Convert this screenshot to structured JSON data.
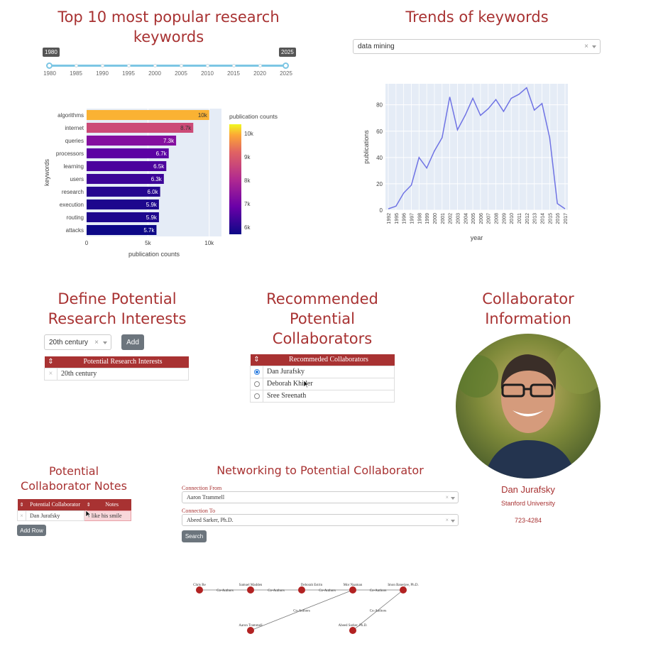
{
  "top_keywords": {
    "title_line1": "Top 10 most popular research",
    "title_line2": "keywords",
    "slider": {
      "min_label": "1980",
      "max_label": "2025",
      "ticks": [
        "1980",
        "1985",
        "1990",
        "1995",
        "2000",
        "2005",
        "2010",
        "2015",
        "2020",
        "2025"
      ]
    }
  },
  "bar_chart": {
    "chart_data": {
      "type": "bar",
      "orientation": "horizontal",
      "categories": [
        "algorithms",
        "internet",
        "queries",
        "processors",
        "learning",
        "users",
        "research",
        "execution",
        "routing",
        "attacks"
      ],
      "values": [
        10000,
        8700,
        7300,
        6700,
        6500,
        6300,
        6000,
        5900,
        5900,
        5700
      ],
      "value_labels": [
        "10k",
        "8.7k",
        "7.3k",
        "6.7k",
        "6.5k",
        "6.3k",
        "6.0k",
        "5.9k",
        "5.9k",
        "5.7k"
      ],
      "xlabel": "publication counts",
      "ylabel": "keywords",
      "x_ticks": [
        "0",
        "5k",
        "10k"
      ],
      "xlim": [
        0,
        11000
      ],
      "colorbar_title": "publication counts",
      "colorbar_ticks": [
        "10k",
        "9k",
        "8k",
        "7k",
        "6k"
      ],
      "colorbar_range": [
        5700,
        10400
      ],
      "bg_color": "#e5ecf6"
    }
  },
  "trends": {
    "title": "Trends of keywords",
    "dropdown_value": "data mining",
    "chart_data": {
      "type": "line",
      "x": [
        "1992",
        "1995",
        "1996",
        "1997",
        "1998",
        "1999",
        "2000",
        "2001",
        "2002",
        "2003",
        "2004",
        "2005",
        "2006",
        "2007",
        "2008",
        "2009",
        "2010",
        "2011",
        "2012",
        "2013",
        "2014",
        "2015",
        "2016",
        "2017"
      ],
      "y": [
        1,
        3,
        13,
        19,
        40,
        32,
        45,
        55,
        86,
        61,
        72,
        85,
        72,
        77,
        84,
        75,
        85,
        88,
        93,
        76,
        81,
        55,
        5,
        1
      ],
      "xlabel": "year",
      "ylabel": "publications",
      "y_ticks": [
        "0",
        "20",
        "40",
        "60",
        "80"
      ],
      "ylim": [
        0,
        96
      ],
      "line_color": "#6f73e4",
      "bg_color": "#e5ecf6"
    }
  },
  "interests": {
    "title_line1": "Define Potential",
    "title_line2": "Research Interests",
    "dropdown_value": "20th century",
    "add_label": "Add",
    "table_header": "Potential Research Interests",
    "rows": [
      "20th century"
    ]
  },
  "recommended": {
    "title_line1": "Recommended",
    "title_line2": "Potential",
    "title_line3": "Collaborators",
    "table_header": "Recommeded Collaborators",
    "rows": [
      "Dan Jurafsky",
      "Deborah Khider",
      "Sree Sreenath"
    ],
    "selected_index": 0
  },
  "collaborator": {
    "title_line1": "Collaborator",
    "title_line2": "Information",
    "name": "Dan Jurafsky",
    "affiliation": "Stanford University",
    "phone": "723-4284"
  },
  "notes": {
    "title_line1": "Potential",
    "title_line2": "Collaborator Notes",
    "col1": "Potential Collaborator",
    "col2": "Notes",
    "row_name": "Dan Jurafsky",
    "row_note": "I like his smile",
    "add_row_label": "Add Row"
  },
  "network": {
    "title": "Networking to Potential Collaborator",
    "from_label": "Connection From",
    "from_value": "Aaron Trammell",
    "to_label": "Connection To",
    "to_value": "Abeed Sarker, Ph.D.",
    "search_label": "Search",
    "nodes": [
      "Chris Re",
      "Samuel Madden",
      "Deborah Estrin",
      "Mor Naaman",
      "Imon Banerjee, Ph.D.",
      "Aaron Trammell",
      "Abeed Sarker, Ph.D."
    ],
    "edge_label": "Co-Authors",
    "node_color": "#b22222"
  }
}
